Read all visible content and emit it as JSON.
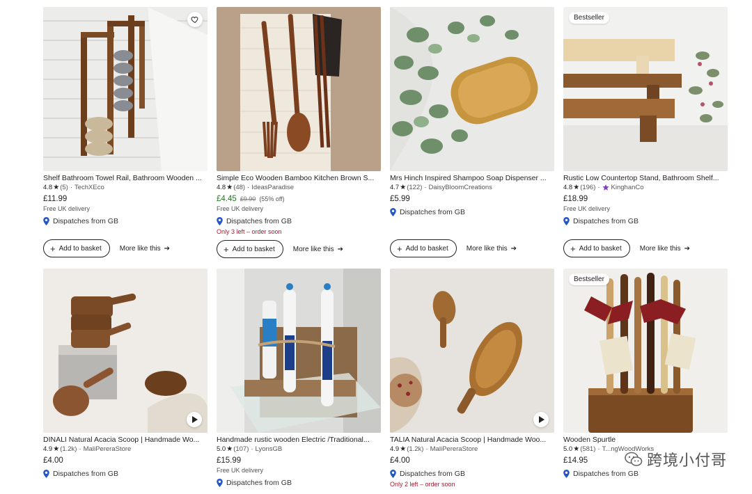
{
  "products": [
    {
      "title": "Shelf Bathroom Towel Rail, Bathroom Wooden ...",
      "rating": "4.8",
      "reviews": "(5)",
      "shop": "TechXEco",
      "price": "£11.99",
      "delivery": "Free UK delivery",
      "dispatch": "Dispatches from GB",
      "add_to_basket": "Add to basket",
      "more_like_this": "More like this",
      "favourite_icon": "heart-icon"
    },
    {
      "title": "Simple Eco Wooden Bamboo Kitchen Brown S...",
      "rating": "4.8",
      "reviews": "(48)",
      "shop": "IdeasParadise",
      "price": "£4.45",
      "original_price": "£9.90",
      "discount": "(55% off)",
      "delivery": "Free UK delivery",
      "dispatch": "Dispatches from GB",
      "stock": "Only 3 left – order soon",
      "add_to_basket": "Add to basket",
      "more_like_this": "More like this"
    },
    {
      "title": "Mrs Hinch Inspired Shampoo Soap Dispenser ...",
      "rating": "4.7",
      "reviews": "(122)",
      "shop": "DaisyBloomCreations",
      "price": "£5.99",
      "dispatch": "Dispatches from GB",
      "add_to_basket": "Add to basket",
      "more_like_this": "More like this"
    },
    {
      "title": "Rustic Low Countertop Stand, Bathroom Shelf...",
      "rating": "4.8",
      "reviews": "(196)",
      "shop": "KinghanCo",
      "price": "£18.99",
      "delivery": "Free UK delivery",
      "dispatch": "Dispatches from GB",
      "badge": "Bestseller",
      "add_to_basket": "Add to basket",
      "more_like_this": "More like this"
    },
    {
      "title": "DINALI Natural Acacia Scoop | Handmade Wo...",
      "rating": "4.9",
      "reviews": "(1.2k)",
      "shop": "MaliPereraStore",
      "price": "£4.00",
      "dispatch": "Dispatches from GB"
    },
    {
      "title": "Handmade rustic wooden Electric /Traditional...",
      "rating": "5.0",
      "reviews": "(107)",
      "shop": "LyonsGB",
      "price": "£15.99",
      "delivery": "Free UK delivery",
      "dispatch": "Dispatches from GB"
    },
    {
      "title": "TALIA Natural Acacia Scoop | Handmade Woo...",
      "rating": "4.9",
      "reviews": "(1.2k)",
      "shop": "MaliPereraStore",
      "price": "£4.00",
      "dispatch": "Dispatches from GB",
      "stock": "Only 2 left – order soon"
    },
    {
      "title": "Wooden Spurtle",
      "rating": "5.0",
      "reviews": "(581)",
      "shop": "T...ngWoodWorks",
      "price": "£14.95",
      "dispatch": "Dispatches from GB",
      "badge": "Bestseller"
    }
  ],
  "watermark": {
    "text": "跨境小付哥",
    "icon": "wechat-icon"
  },
  "colors": {
    "sale_price": "#257a26",
    "low_stock": "#a61a2e",
    "star_seller": "#7f3fbf",
    "location_pin": "#2457c5"
  }
}
